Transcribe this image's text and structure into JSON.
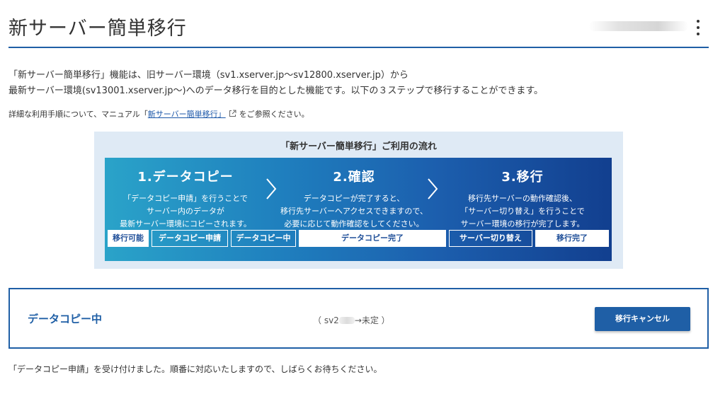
{
  "header": {
    "title": "新サーバー簡単移行"
  },
  "description": {
    "line1": "「新サーバー簡単移行」機能は、旧サーバー環境（sv1.xserver.jp～sv12800.xserver.jp）から",
    "line2": "最新サーバー環境(sv13001.xserver.jp～)へのデータ移行を目的とした機能です。以下の３ステップで移行することができます。",
    "manual_prefix": "詳細な利用手順について、マニュアル「",
    "manual_link": "新サーバー簡単移行」",
    "manual_suffix": "をご参照ください。"
  },
  "flow": {
    "title": "「新サーバー簡単移行」ご利用の流れ",
    "steps": [
      {
        "title": "1.データコピー",
        "lines": [
          "「データコピー申請」を行うことで",
          "サーバー内のデータが",
          "最新サーバー環境にコピーされます。"
        ]
      },
      {
        "title": "2.確認",
        "lines": [
          "データコピーが完了すると、",
          "移行先サーバーへアクセスできますので、",
          "必要に応じて動作確認をしてください。"
        ]
      },
      {
        "title": "3.移行",
        "lines": [
          "移行先サーバーの動作確認後、",
          "「サーバー切り替え」を行うことで",
          "サーバー環境の移行が完了します。"
        ]
      }
    ],
    "progress": [
      "移行可能",
      "データコピー申請",
      "データコピー中",
      "データコピー完了",
      "サーバー切り替え",
      "移行完了"
    ]
  },
  "status": {
    "label": "データコピー中",
    "server_prefix": "（ sv2",
    "server_suffix": "→未定 ）",
    "cancel_label": "移行キャンセル"
  },
  "notice": "「データコピー申請」を受け付けました。順番に対応いたしますので、しばらくお待ちください。",
  "colors": {
    "accent": "#1f5fa6",
    "panel_start": "#2aa3c9",
    "panel_end": "#123f8f",
    "flow_bg": "#dfeaf5"
  },
  "icons": [
    "more-vert-icon",
    "external-link-icon",
    "chevron-right-icon"
  ]
}
